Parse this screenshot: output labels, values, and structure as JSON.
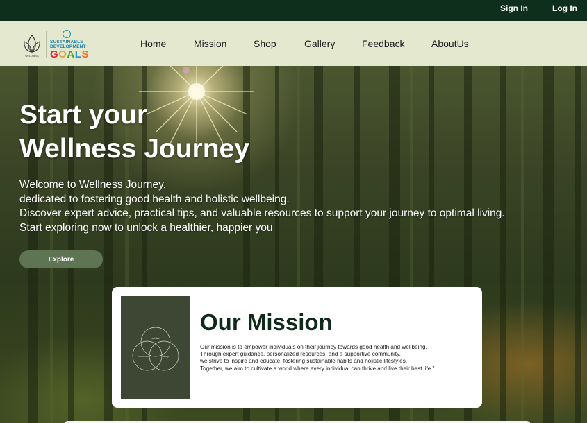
{
  "topbar": {
    "sign_in": "Sign In",
    "log_in": "Log In"
  },
  "brand": {
    "logo_text": "WELLNESS",
    "sdg_line1": "SUSTAINABLE",
    "sdg_line2": "DEVELOPMENT",
    "sdg_goals": [
      "G",
      "O",
      "A",
      "L",
      "S"
    ]
  },
  "nav": {
    "items": [
      "Home",
      "Mission",
      "Shop",
      "Gallery",
      "Feedback",
      "AboutUs"
    ]
  },
  "hero": {
    "title_line1": "Start your",
    "title_line2": "Wellness Journey",
    "text_lines": [
      "Welcome to Wellness Journey,",
      "dedicated to fostering good health and holistic wellbeing.",
      "Discover expert advice, practical tips, and valuable resources to support your journey to optimal living.",
      "Start exploring now to unlock a healthier, happier you"
    ],
    "button": "Explore"
  },
  "mission": {
    "title": "Our Mission",
    "image_labels": [
      "nutrition",
      "movement",
      "sleep"
    ],
    "text_lines": [
      "Our mission is to empower individuals on their journey towards good health and wellbeing.",
      "Through expert guidance, personalized resources, and a supportive community,",
      "we strive to inspire and educate, fostering sustainable habits and holistic lifestyles.",
      "Together, we aim to cultivate a world where every individual can thrive and live their best life.\""
    ]
  },
  "colors": {
    "topbar": "#0e2f1c",
    "navbar": "#e3e8cf",
    "button": "#5e7453",
    "mission_title": "#0f2a18",
    "mission_image": "#3e4733"
  },
  "icons": {
    "logo": "lotus-logo-icon",
    "un": "un-emblem-icon"
  }
}
